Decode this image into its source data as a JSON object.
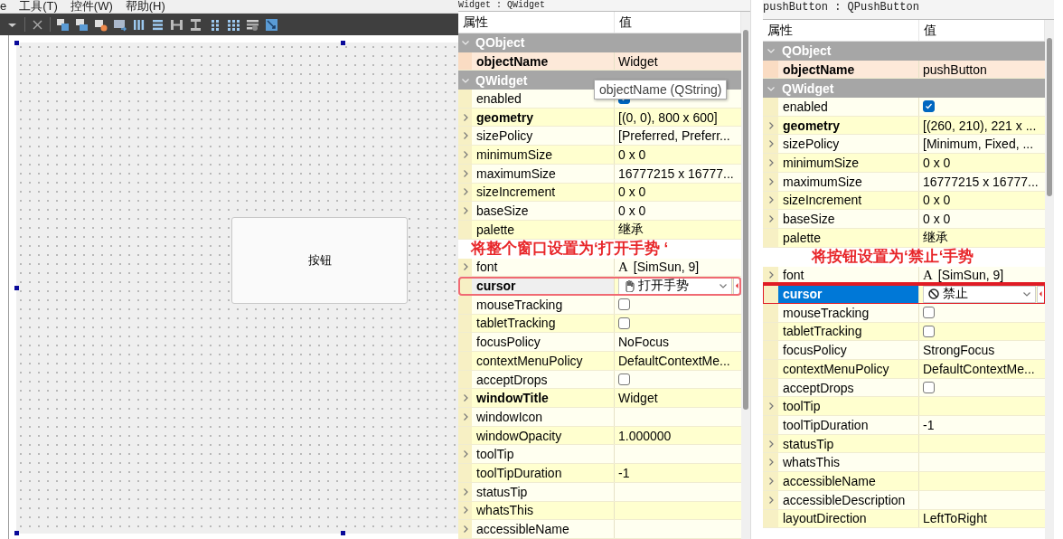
{
  "menu": [
    {
      "label": "e"
    },
    {
      "label": "工具(T)"
    },
    {
      "label": "控件(W)"
    },
    {
      "label": "帮助(H)"
    }
  ],
  "form": {
    "button": "按钮"
  },
  "panels": [
    {
      "title": "Widget : QWidget",
      "columns": [
        "属性",
        "值"
      ],
      "tooltip": "objectName (QString)",
      "rows": [
        {
          "kind": "group",
          "name": "QObject",
          "expanded": true
        },
        {
          "kind": "text",
          "name": "objectName",
          "value": "Widget",
          "bold": true,
          "expandable": false,
          "highlight": true,
          "selected": false
        },
        {
          "kind": "group",
          "name": "QWidget",
          "expanded": true
        },
        {
          "kind": "check",
          "name": "enabled",
          "checked": true,
          "bold": false,
          "expandable": false,
          "highlight": false,
          "selected": false
        },
        {
          "kind": "text",
          "name": "geometry",
          "value": "[(0, 0), 800 x 600]",
          "bold": true,
          "expandable": true,
          "highlight": false,
          "selected": false
        },
        {
          "kind": "text",
          "name": "sizePolicy",
          "value": "[Preferred, Preferr...",
          "bold": false,
          "expandable": true,
          "highlight": false,
          "selected": false
        },
        {
          "kind": "text",
          "name": "minimumSize",
          "value": "0 x 0",
          "bold": false,
          "expandable": true,
          "highlight": false,
          "selected": false
        },
        {
          "kind": "text",
          "name": "maximumSize",
          "value": "16777215 x 16777...",
          "bold": false,
          "expandable": true,
          "highlight": false,
          "selected": false
        },
        {
          "kind": "text",
          "name": "sizeIncrement",
          "value": "0 x 0",
          "bold": false,
          "expandable": true,
          "highlight": false,
          "selected": false
        },
        {
          "kind": "text",
          "name": "baseSize",
          "value": "0 x 0",
          "bold": false,
          "expandable": true,
          "highlight": false,
          "selected": false
        },
        {
          "kind": "text",
          "name": "palette",
          "value": "继承",
          "bold": false,
          "expandable": false,
          "highlight": false,
          "selected": false
        },
        {
          "kind": "annotation",
          "text": "将整个窗口设置为‘打开手势 ‘"
        },
        {
          "kind": "font",
          "name": "font",
          "glyph": "A",
          "value": "[SimSun, 9]",
          "bold": false,
          "expandable": true,
          "highlight": false,
          "selected": false
        },
        {
          "kind": "combo",
          "name": "cursor",
          "value": "打开手势",
          "bold": true,
          "expandable": false,
          "highlight": false,
          "selected": false,
          "marked": true
        },
        {
          "kind": "check",
          "name": "mouseTracking",
          "checked": false,
          "bold": false,
          "expandable": false,
          "highlight": false,
          "selected": false
        },
        {
          "kind": "check",
          "name": "tabletTracking",
          "checked": false,
          "bold": false,
          "expandable": false,
          "highlight": false,
          "selected": false
        },
        {
          "kind": "text",
          "name": "focusPolicy",
          "value": "NoFocus",
          "bold": false,
          "expandable": false,
          "highlight": false,
          "selected": false
        },
        {
          "kind": "text",
          "name": "contextMenuPolicy",
          "value": "DefaultContextMe...",
          "bold": false,
          "expandable": false,
          "highlight": false,
          "selected": false
        },
        {
          "kind": "check",
          "name": "acceptDrops",
          "checked": false,
          "bold": false,
          "expandable": false,
          "highlight": false,
          "selected": false
        },
        {
          "kind": "text",
          "name": "windowTitle",
          "value": "Widget",
          "bold": true,
          "expandable": true,
          "highlight": false,
          "selected": false
        },
        {
          "kind": "text",
          "name": "windowIcon",
          "bold": false,
          "expandable": true,
          "highlight": false,
          "selected": false
        },
        {
          "kind": "text",
          "name": "windowOpacity",
          "value": "1.000000",
          "bold": false,
          "expandable": false,
          "highlight": false,
          "selected": false
        },
        {
          "kind": "text",
          "name": "toolTip",
          "bold": false,
          "expandable": true,
          "highlight": false,
          "selected": false
        },
        {
          "kind": "text",
          "name": "toolTipDuration",
          "value": "-1",
          "bold": false,
          "expandable": false,
          "highlight": false,
          "selected": false
        },
        {
          "kind": "text",
          "name": "statusTip",
          "bold": false,
          "expandable": true,
          "highlight": false,
          "selected": false
        },
        {
          "kind": "text",
          "name": "whatsThis",
          "bold": false,
          "expandable": true,
          "highlight": false,
          "selected": false
        },
        {
          "kind": "text",
          "name": "accessibleName",
          "bold": false,
          "expandable": true,
          "highlight": false,
          "selected": false
        }
      ]
    },
    {
      "title": "pushButton : QPushButton",
      "columns": [
        "属性",
        "值"
      ],
      "rows": [
        {
          "kind": "group",
          "name": "QObject",
          "expanded": true
        },
        {
          "kind": "text",
          "name": "objectName",
          "value": "pushButton",
          "bold": true,
          "expandable": false,
          "highlight": true,
          "selected": false
        },
        {
          "kind": "group",
          "name": "QWidget",
          "expanded": true
        },
        {
          "kind": "check",
          "name": "enabled",
          "checked": true,
          "bold": false,
          "expandable": false,
          "highlight": false,
          "selected": false
        },
        {
          "kind": "text",
          "name": "geometry",
          "value": "[(260, 210), 221 x ...",
          "bold": true,
          "expandable": true,
          "highlight": false,
          "selected": false
        },
        {
          "kind": "text",
          "name": "sizePolicy",
          "value": "[Minimum, Fixed, ...",
          "bold": false,
          "expandable": true,
          "highlight": false,
          "selected": false
        },
        {
          "kind": "text",
          "name": "minimumSize",
          "value": "0 x 0",
          "bold": false,
          "expandable": true,
          "highlight": false,
          "selected": false
        },
        {
          "kind": "text",
          "name": "maximumSize",
          "value": "16777215 x 16777...",
          "bold": false,
          "expandable": true,
          "highlight": false,
          "selected": false
        },
        {
          "kind": "text",
          "name": "sizeIncrement",
          "value": "0 x 0",
          "bold": false,
          "expandable": true,
          "highlight": false,
          "selected": false
        },
        {
          "kind": "text",
          "name": "baseSize",
          "value": "0 x 0",
          "bold": false,
          "expandable": true,
          "highlight": false,
          "selected": false
        },
        {
          "kind": "text",
          "name": "palette",
          "value": "继承",
          "bold": false,
          "expandable": false,
          "highlight": false,
          "selected": false
        },
        {
          "kind": "annotation",
          "text": "将按钮设置为‘禁止‘手势"
        },
        {
          "kind": "font",
          "name": "font",
          "glyph": "A",
          "value": "[SimSun, 9]",
          "bold": false,
          "expandable": true,
          "highlight": false,
          "selected": false
        },
        {
          "kind": "combo",
          "name": "cursor",
          "value": "禁止",
          "bold": true,
          "expandable": false,
          "highlight": false,
          "selected": true,
          "marked": true
        },
        {
          "kind": "check",
          "name": "mouseTracking",
          "checked": false,
          "bold": false,
          "expandable": false,
          "highlight": false,
          "selected": false
        },
        {
          "kind": "check",
          "name": "tabletTracking",
          "checked": false,
          "bold": false,
          "expandable": false,
          "highlight": false,
          "selected": false
        },
        {
          "kind": "text",
          "name": "focusPolicy",
          "value": "StrongFocus",
          "bold": false,
          "expandable": false,
          "highlight": false,
          "selected": false
        },
        {
          "kind": "text",
          "name": "contextMenuPolicy",
          "value": "DefaultContextMe...",
          "bold": false,
          "expandable": false,
          "highlight": false,
          "selected": false
        },
        {
          "kind": "check",
          "name": "acceptDrops",
          "checked": false,
          "bold": false,
          "expandable": false,
          "highlight": false,
          "selected": false
        },
        {
          "kind": "text",
          "name": "toolTip",
          "bold": false,
          "expandable": true,
          "highlight": false,
          "selected": false
        },
        {
          "kind": "text",
          "name": "toolTipDuration",
          "value": "-1",
          "bold": false,
          "expandable": false,
          "highlight": false,
          "selected": false
        },
        {
          "kind": "text",
          "name": "statusTip",
          "bold": false,
          "expandable": true,
          "highlight": false,
          "selected": false
        },
        {
          "kind": "text",
          "name": "whatsThis",
          "bold": false,
          "expandable": true,
          "highlight": false,
          "selected": false
        },
        {
          "kind": "text",
          "name": "accessibleName",
          "bold": false,
          "expandable": true,
          "highlight": false,
          "selected": false
        },
        {
          "kind": "text",
          "name": "accessibleDescription",
          "bold": false,
          "expandable": true,
          "highlight": false,
          "selected": false
        },
        {
          "kind": "text",
          "name": "layoutDirection",
          "value": "LeftToRight",
          "bold": false,
          "expandable": false,
          "highlight": false,
          "selected": false
        }
      ]
    }
  ]
}
